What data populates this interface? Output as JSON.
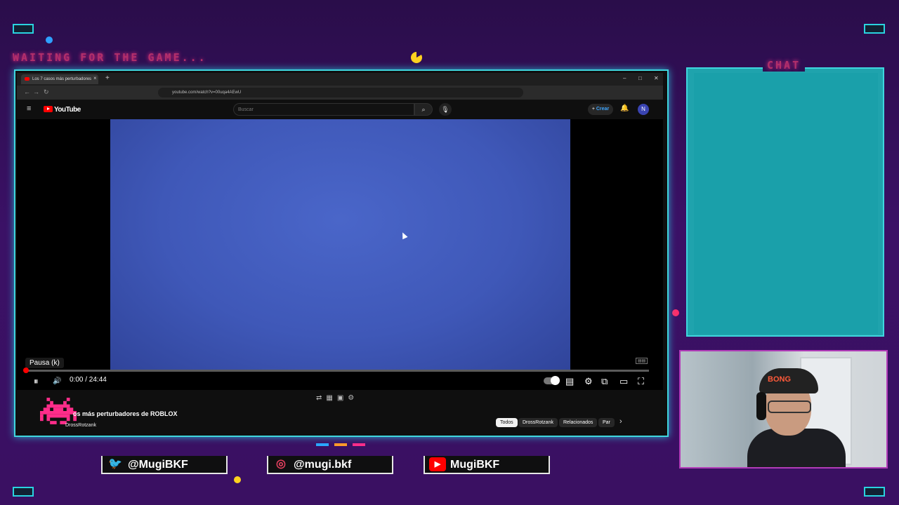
{
  "overlay": {
    "waiting_text": "WAITING FOR THE GAME...",
    "chat_label": "CHAT",
    "accent_cyan": "#3fd6de",
    "accent_pink": "#ff2d8a"
  },
  "browser": {
    "tab_title": "Los 7 casos más perturbadores",
    "tab_close": "×",
    "new_tab": "+",
    "url": "youtube.com/watch?v=00uqa4AEwU",
    "window_min": "–",
    "window_max": "□",
    "window_close": "✕",
    "back_icon": "←",
    "forward_icon": "→",
    "reload_icon": "↻"
  },
  "youtube": {
    "menu_icon": "≡",
    "logo_text": "YouTube",
    "search_placeholder": "Buscar",
    "search_icon": "⌕",
    "mic_icon": "🎙",
    "create_plus": "+",
    "create_label": "Crear",
    "bell_icon": "🔔",
    "avatar_initial": "N"
  },
  "player": {
    "tooltip": "Pausa (k)",
    "pause_icon": "⏸",
    "volume_icon": "🔊",
    "current_time": "0:00",
    "duration": "24:44",
    "time_display": "0:00 / 24:44",
    "progress_fraction": 0,
    "subtitles_icon": "▤",
    "settings_icon": "⚙",
    "miniplayer_icon": "⧉",
    "theater_icon": "▭",
    "fullscreen_icon": "⛶"
  },
  "video": {
    "title": "Los 7 casos más perturbadores de ROBLOX",
    "title_visible": "os más perturbadores de ROBLOX",
    "channel": "DrossRotzank"
  },
  "chips": [
    {
      "label": "Todos",
      "active": true
    },
    {
      "label": "DrossRotzank",
      "active": false
    },
    {
      "label": "Relacionados",
      "active": false
    },
    {
      "label": "Par",
      "active": false
    }
  ],
  "chips_next": "›",
  "socials": [
    {
      "platform": "twitter-icon",
      "handle": "@MugiBKF",
      "color": "#1da1f2"
    },
    {
      "platform": "instagram-icon",
      "handle": "@mugi.bkf",
      "color": "#e4405f"
    },
    {
      "platform": "youtube-icon",
      "handle": "MugiBKF",
      "color": "#ff0000"
    }
  ],
  "webcam": {
    "cap_text": "BONG"
  }
}
